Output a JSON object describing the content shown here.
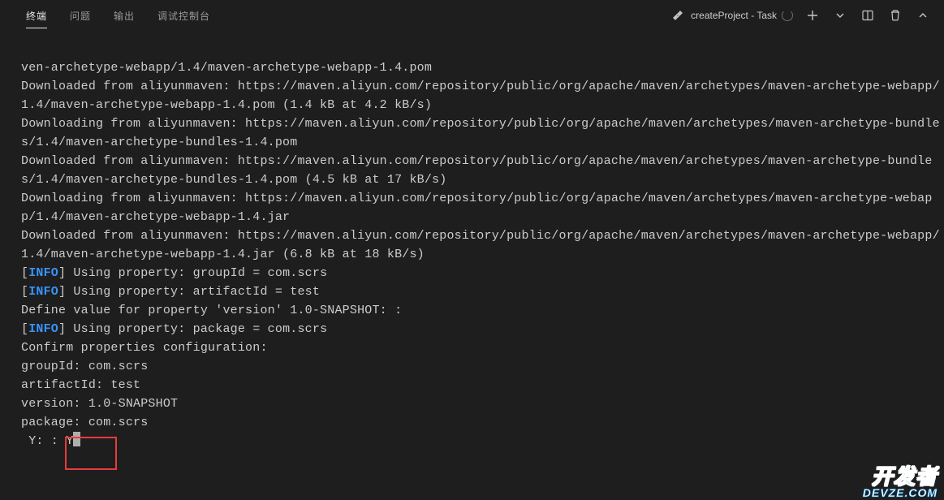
{
  "tabs": {
    "terminal": "终端",
    "problems": "问题",
    "output": "输出",
    "debug_console": "调试控制台"
  },
  "task": {
    "icon": "tools-icon",
    "label": "createProject - Task"
  },
  "terminal": {
    "lines": [
      {
        "type": "plain",
        "text": "ven-archetype-webapp/1.4/maven-archetype-webapp-1.4.pom"
      },
      {
        "type": "plain",
        "text": "Downloaded from aliyunmaven: https://maven.aliyun.com/repository/public/org/apache/maven/archetypes/maven-archetype-webapp/1.4/maven-archetype-webapp-1.4.pom (1.4 kB at 4.2 kB/s)"
      },
      {
        "type": "plain",
        "text": "Downloading from aliyunmaven: https://maven.aliyun.com/repository/public/org/apache/maven/archetypes/maven-archetype-bundles/1.4/maven-archetype-bundles-1.4.pom"
      },
      {
        "type": "plain",
        "text": "Downloaded from aliyunmaven: https://maven.aliyun.com/repository/public/org/apache/maven/archetypes/maven-archetype-bundles/1.4/maven-archetype-bundles-1.4.pom (4.5 kB at 17 kB/s)"
      },
      {
        "type": "plain",
        "text": "Downloading from aliyunmaven: https://maven.aliyun.com/repository/public/org/apache/maven/archetypes/maven-archetype-webapp/1.4/maven-archetype-webapp-1.4.jar"
      },
      {
        "type": "plain",
        "text": "Downloaded from aliyunmaven: https://maven.aliyun.com/repository/public/org/apache/maven/archetypes/maven-archetype-webapp/1.4/maven-archetype-webapp-1.4.jar (6.8 kB at 18 kB/s)"
      },
      {
        "type": "info",
        "text": "Using property: groupId = com.scrs"
      },
      {
        "type": "info",
        "text": "Using property: artifactId = test"
      },
      {
        "type": "plain",
        "text": "Define value for property 'version' 1.0-SNAPSHOT: :"
      },
      {
        "type": "info",
        "text": "Using property: package = com.scrs"
      },
      {
        "type": "plain",
        "text": "Confirm properties configuration:"
      },
      {
        "type": "plain",
        "text": "groupId: com.scrs"
      },
      {
        "type": "plain",
        "text": "artifactId: test"
      },
      {
        "type": "plain",
        "text": "version: 1.0-SNAPSHOT"
      },
      {
        "type": "plain",
        "text": "package: com.scrs"
      }
    ],
    "prompt_prefix": " Y: : ",
    "prompt_input": "Y",
    "info_tag": "INFO"
  },
  "watermark": {
    "cn": "开发者",
    "en": "DEVZE.COM"
  }
}
